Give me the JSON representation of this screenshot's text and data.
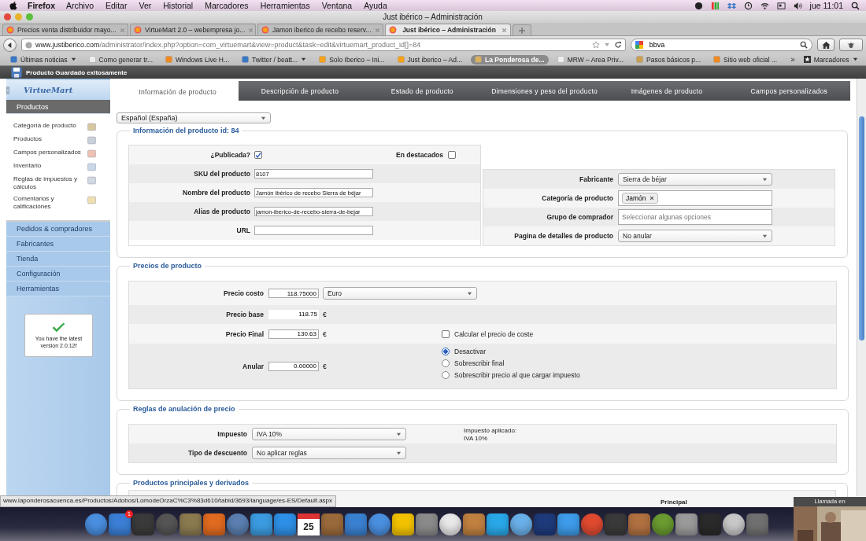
{
  "menubar": {
    "app": "Firefox",
    "items": [
      "Archivo",
      "Editar",
      "Ver",
      "Historial",
      "Marcadores",
      "Herramientas",
      "Ventana",
      "Ayuda"
    ],
    "clock": "jue 11:01"
  },
  "window": {
    "title": "Just ibérico – Administración"
  },
  "tabs": [
    {
      "label": "Precios venta distribuidor mayo...",
      "selected": false
    },
    {
      "label": "VirtueMart 2.0 – webempresa jo...",
      "selected": false
    },
    {
      "label": "Jamon iberico de recebo reserv...",
      "selected": false
    },
    {
      "label": "Just ibérico – Administración",
      "selected": true
    }
  ],
  "address": {
    "host": "www.justiberico.com",
    "path": "/administrator/index.php?option=com_virtuemart&view=product&task=edit&virtuemart_product_id[]=84",
    "search": "bbva"
  },
  "bookmarks": [
    {
      "label": "Últimas noticias",
      "dropdown": true,
      "selected": false
    },
    {
      "label": "Como generar tr...",
      "dropdown": false,
      "selected": false
    },
    {
      "label": "Windows Live H...",
      "dropdown": false,
      "selected": false
    },
    {
      "label": "Twitter / beatt...",
      "dropdown": true,
      "selected": false
    },
    {
      "label": "Solo Iberico – Ini...",
      "dropdown": false,
      "selected": false
    },
    {
      "label": "Just iberico – Ad...",
      "dropdown": false,
      "selected": false
    },
    {
      "label": "La Ponderosa de...",
      "dropdown": false,
      "selected": true
    },
    {
      "label": "MRW – Area Priv...",
      "dropdown": false,
      "selected": false
    },
    {
      "label": "Pasos básicos p...",
      "dropdown": false,
      "selected": false
    },
    {
      "label": "Sitio web oficial ...",
      "dropdown": false,
      "selected": false
    }
  ],
  "bookmarks_more": "»",
  "bookmarks_menu": "Marcadores",
  "notice": "Producto Guardado exitosamente",
  "sidebar": {
    "logo": "VirtueMart",
    "sections": [
      {
        "label": "Productos",
        "expanded": true,
        "items": [
          "Categoría de producto",
          "Productos",
          "Campos personalizados",
          "Inventario",
          "Reglas de impuestos y cálculos",
          "Comentarios y calificaciónes"
        ]
      },
      {
        "label": "Pedidos & compradores",
        "expanded": false
      },
      {
        "label": "Fabricantes",
        "expanded": false
      },
      {
        "label": "Tienda",
        "expanded": false
      },
      {
        "label": "Configuración",
        "expanded": false
      },
      {
        "label": "Herramientas",
        "expanded": false
      }
    ],
    "version": "You have the latest version 2.0.12f"
  },
  "product_tabs": [
    {
      "label": "Información de producto",
      "selected": true
    },
    {
      "label": "Descripción de producto",
      "selected": false
    },
    {
      "label": "Estado de producto",
      "selected": false
    },
    {
      "label": "Dimensiones y peso del producto",
      "selected": false
    },
    {
      "label": "Imágenes de producto",
      "selected": false
    },
    {
      "label": "Campos personalizados",
      "selected": false
    }
  ],
  "language": "Español (España)",
  "info": {
    "legend": "Información del producto id: 84",
    "left_rows": [
      {
        "kind": "checks",
        "checks": [
          {
            "label": "¿Publicada?",
            "checked": true
          },
          {
            "label": "En destacados",
            "checked": false
          }
        ]
      },
      {
        "kind": "input",
        "label": "SKU del producto",
        "value": "8107"
      },
      {
        "kind": "input",
        "label": "Nombre del producto",
        "value": "Jamón ibérico de recebo Sierra de béjar"
      },
      {
        "kind": "input",
        "label": "Alias de producto",
        "value": "jamon-iberico-de-recebo-sierra-de-bejar"
      },
      {
        "kind": "input",
        "label": "URL",
        "value": ""
      }
    ],
    "right_rows": [
      {
        "kind": "select",
        "label": "Fabricante",
        "value": "Sierra de béjar"
      },
      {
        "kind": "tags",
        "label": "Categoría de producto",
        "tags": [
          "Jamón"
        ]
      },
      {
        "kind": "placeholder",
        "label": "Grupo de comprador",
        "placeholder": "Seleccionar algunas opciones"
      },
      {
        "kind": "select",
        "label": "Pagina de detalles de producto",
        "value": "No anular"
      }
    ]
  },
  "prices": {
    "legend": "Precios de producto",
    "rows": [
      {
        "label": "Precio costo",
        "value": "118.75000",
        "kind": "input",
        "currency_select": "Euro"
      },
      {
        "label": "Precio base",
        "value": "118.75",
        "kind": "plain",
        "suffix": "€"
      },
      {
        "label": "Precio Final",
        "value": "130.63",
        "kind": "input",
        "suffix": "€",
        "checkbox": {
          "label": "Calcular el precio de coste",
          "checked": false
        }
      },
      {
        "label": "Anular",
        "value": "0.00000",
        "kind": "input",
        "suffix": "€",
        "radios": [
          {
            "label": "Desactivar",
            "selected": true
          },
          {
            "label": "Sobrescribir final",
            "selected": false
          },
          {
            "label": "Sobrescribir precio al que cargar impuesto",
            "selected": false
          }
        ]
      }
    ]
  },
  "override": {
    "legend": "Reglas de anulación de precio",
    "rows": [
      {
        "label": "Impuesto",
        "value": "IVA 10%"
      },
      {
        "label": "Tipo de descuento",
        "value": "No aplicar reglas"
      }
    ],
    "note": [
      "Impuesto aplicado:",
      "IVA 10%"
    ]
  },
  "related": {
    "legend": "Productos principales y derivados",
    "column": "Principal"
  },
  "status_url": "www.laponderosacuenca.es/Productos/Adobos/LomodeOrzaC%C3%83d610/tabid/3693/language/es-ES/Default.aspx",
  "dock": {
    "badge": "1",
    "calendar_day": "25"
  },
  "call_window": {
    "title": "Llamada en"
  }
}
